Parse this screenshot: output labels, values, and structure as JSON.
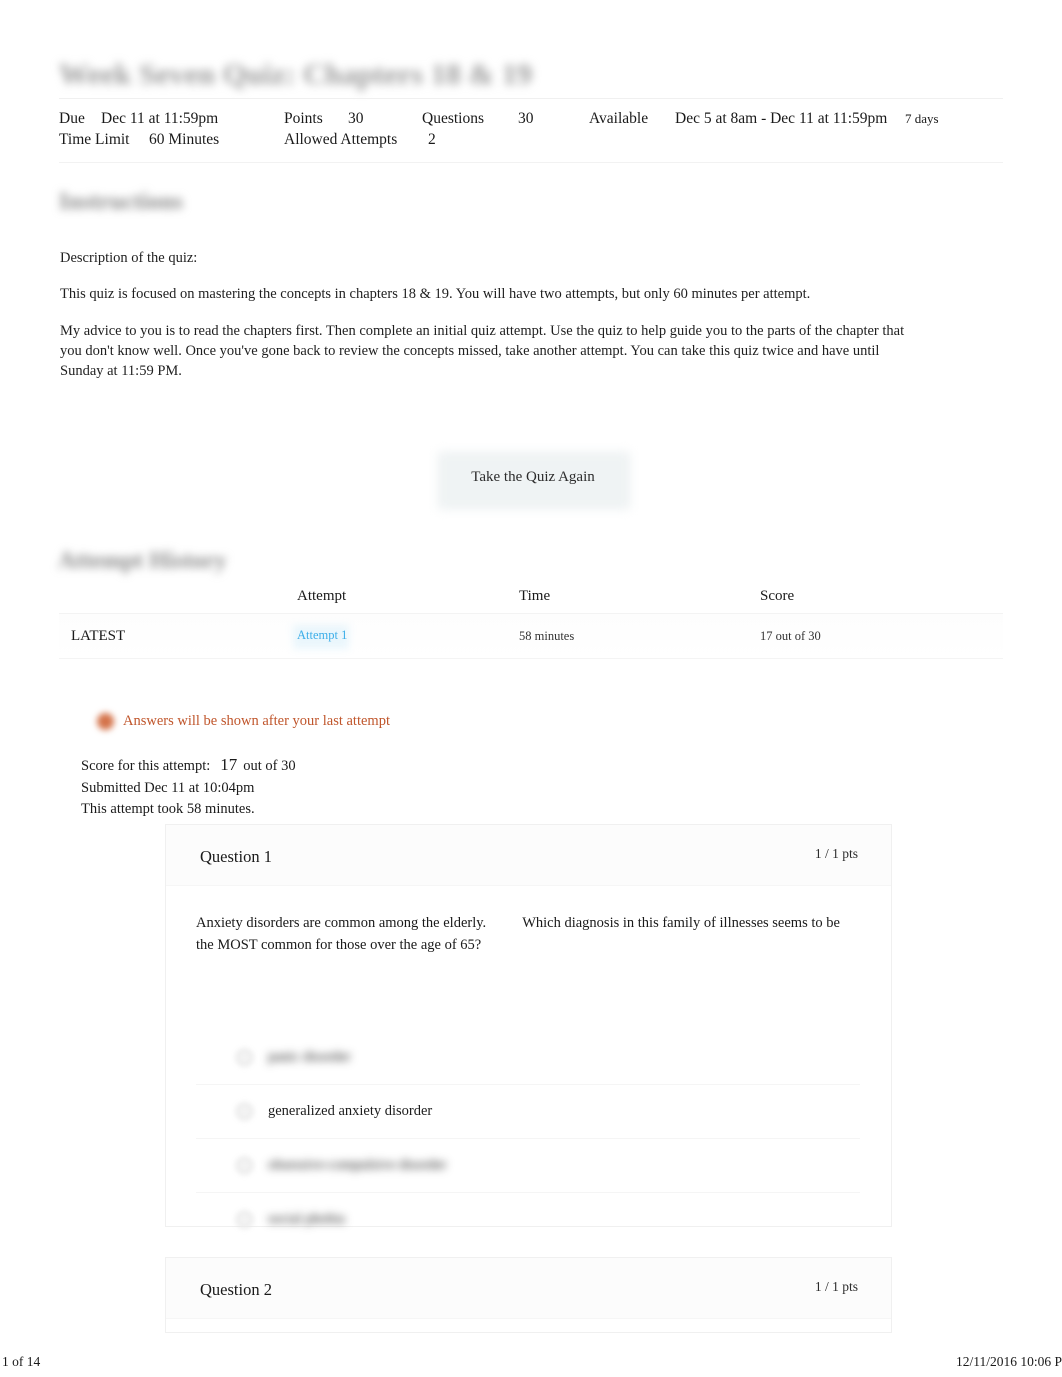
{
  "quiz": {
    "title": "Week Seven Quiz: Chapters 18 & 19",
    "title_redacted": true
  },
  "details": {
    "due_label": "Due",
    "due_value": "Dec 11 at 11:59pm",
    "points_label": "Points",
    "points_value": "30",
    "questions_label": "Questions",
    "questions_value": "30",
    "available_label": "Available",
    "available_value": "Dec 5 at 8am - Dec 11 at 11:59pm",
    "available_duration": "7 days",
    "time_limit_label": "Time Limit",
    "time_limit_value": "60 Minutes",
    "allowed_attempts_label": "Allowed Attempts",
    "allowed_attempts_value": "2"
  },
  "instructions": {
    "heading": "Instructions",
    "heading_redacted": true,
    "paragraphs": [
      "Description of the quiz:",
      "This quiz is focused on mastering the concepts in chapters 18 & 19. You will have two attempts, but only 60 minutes per attempt.",
      "My advice to you is to read the chapters first. Then complete an initial quiz attempt. Use the quiz to help guide you to the parts of the chapter that you don't know well. Once you've gone back to review the concepts missed, take another attempt. You can take this quiz twice and have until Sunday at 11:59 PM."
    ]
  },
  "actions": {
    "retake_label": "Take the Quiz Again"
  },
  "attempt_history": {
    "heading": "Attempt History",
    "heading_redacted": true,
    "columns": [
      "",
      "Attempt",
      "Time",
      "Score"
    ],
    "rows": [
      {
        "latest": "LATEST",
        "attempt": "Attempt 1",
        "time": "58 minutes",
        "score": "17 out of 30"
      }
    ]
  },
  "notice": {
    "icon": "alert-circle-icon",
    "text": "Answers will be shown after your last attempt",
    "color": "#c0562c"
  },
  "attempt_summary": {
    "score_label": "Score for this attempt:",
    "score_value": "17",
    "score_suffix": "out of 30",
    "submitted": "Submitted Dec 11 at 10:04pm",
    "duration": "This attempt took 58 minutes."
  },
  "questions": [
    {
      "title": "Question 1",
      "points": "1 / 1 pts",
      "prompt_segment_1": "Anxiety disorders are common among the elderly.",
      "prompt_segment_2": "Which diagnosis in this family of illnesses seems to be",
      "prompt_segment_3": "the MOST common for those over the age of 65?",
      "options": [
        {
          "text": "panic disorder",
          "redacted": true,
          "selected": false
        },
        {
          "text": "generalized anxiety disorder",
          "redacted": false,
          "selected": true
        },
        {
          "text": "obsessive-compulsive disorder",
          "redacted": true,
          "selected": false
        },
        {
          "text": "social phobia",
          "redacted": true,
          "selected": false
        }
      ]
    },
    {
      "title": "Question 2",
      "points": "1 / 1 pts",
      "prompt_segment_1": "",
      "prompt_segment_2": "",
      "prompt_segment_3": "",
      "options": []
    }
  ],
  "footer": {
    "page_indicator": "1 of 14",
    "timestamp": "12/11/2016 10:06 P"
  },
  "colors": {
    "link": "#3daee9",
    "notice": "#c0562c",
    "text": "#1a1a1a"
  }
}
